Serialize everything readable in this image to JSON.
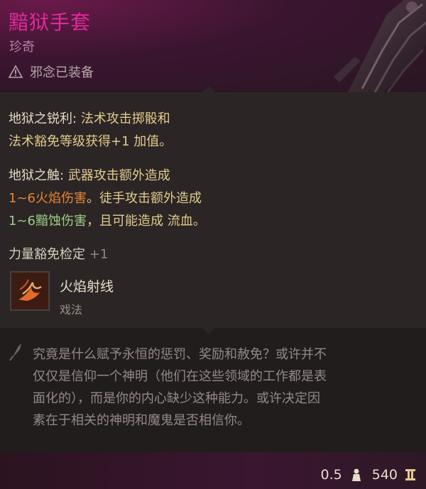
{
  "item": {
    "name": "黯狱手套",
    "rarity": "珍奇",
    "status": "邪念已装备"
  },
  "effects": {
    "effect1_name": "地狱之锐利:",
    "effect1_line1": "法术攻击掷骰和",
    "effect1_line2": "法术豁免等级获得+1 加值。",
    "effect2_name": "地狱之触:",
    "effect2_line1": "武器攻击额外造成",
    "effect2_fire": "1~6火焰伤害",
    "effect2_line2_rest": "。徒手攻击额外造成",
    "effect2_necro": "1~6黯蚀伤害",
    "effect2_line3_mid": "，且可能造成",
    "effect2_bleed": "流血",
    "effect2_end": "。",
    "modifier_label": "力量豁免检定",
    "modifier_value": "+1"
  },
  "spell": {
    "name": "火焰射线",
    "type": "戏法",
    "icon": "fire-ray-icon"
  },
  "lore": {
    "line1": "究竟是什么赋予永恒的惩罚、奖励和赦免？或许并不",
    "line2": "仅仅是信仰一个神明（他们在这些领域的工作都是表",
    "line3": "面化的），而是你的内心缺少这种能力。或许决定因",
    "line4": "素在于相关的神明和魔鬼是否相信你。"
  },
  "footer": {
    "weight": "0.5",
    "price": "540",
    "weight_icon": "weight-icon",
    "price_icon": "coin-icon"
  },
  "colors": {
    "title": "#e0299a",
    "fire": "#e68436",
    "necrotic": "#9dcc86",
    "gold_text": "#e1ca8e"
  }
}
